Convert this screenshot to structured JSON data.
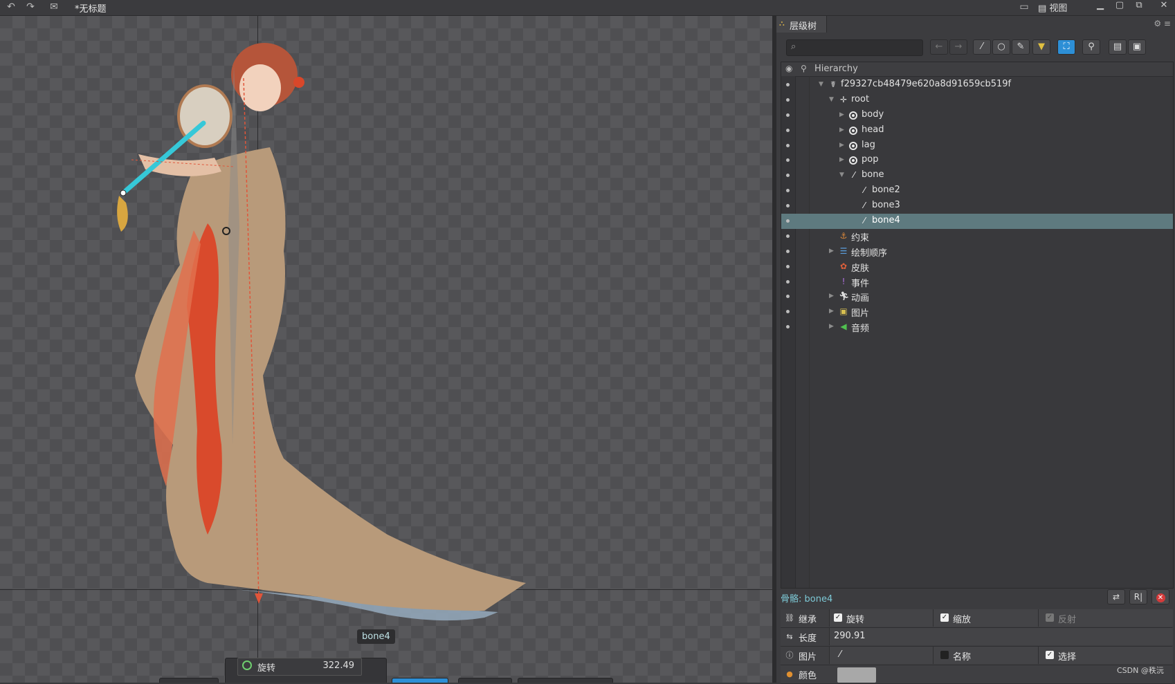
{
  "window": {
    "title": "*无标题",
    "view_menu": "视图",
    "colors": {
      "bg": "#3a3a3c",
      "accent": "#2d8fd6",
      "selection": "#5e7a7f",
      "bone_cyan": "#36c8d8"
    }
  },
  "viewport": {
    "selected_bone_tag": "bone4",
    "transform": {
      "rotate_label": "旋转",
      "rotate_value": "322.49"
    }
  },
  "panel": {
    "tab_label": "层级树",
    "search_placeholder": "",
    "hierarchy_label": "Hierarchy",
    "tree": [
      {
        "label": "f29327cb48479e620a8d91659cb519f",
        "icon": "skeleton-icon",
        "arrow": "down"
      },
      {
        "label": "root",
        "icon": "root-bone-icon",
        "arrow": "down"
      },
      {
        "label": "body",
        "icon": "slot-icon",
        "arrow": "right"
      },
      {
        "label": "head",
        "icon": "slot-icon",
        "arrow": "right"
      },
      {
        "label": "lag",
        "icon": "slot-icon",
        "arrow": "right"
      },
      {
        "label": "pop",
        "icon": "slot-icon",
        "arrow": "right"
      },
      {
        "label": "bone",
        "icon": "bone-icon",
        "arrow": "down"
      },
      {
        "label": "bone2",
        "icon": "bone-icon",
        "arrow": ""
      },
      {
        "label": "bone3",
        "icon": "bone-icon",
        "arrow": ""
      },
      {
        "label": "bone4",
        "icon": "bone-icon",
        "arrow": "",
        "selected": true
      },
      {
        "label": "约束",
        "icon": "constraint-icon",
        "arrow": ""
      },
      {
        "label": "绘制顺序",
        "icon": "draw-order-icon",
        "arrow": "right"
      },
      {
        "label": "皮肤",
        "icon": "skin-icon",
        "arrow": ""
      },
      {
        "label": "事件",
        "icon": "event-icon",
        "arrow": ""
      },
      {
        "label": "动画",
        "icon": "animation-icon",
        "arrow": "right"
      },
      {
        "label": "图片",
        "icon": "images-icon",
        "arrow": "right"
      },
      {
        "label": "音频",
        "icon": "audio-icon",
        "arrow": "right"
      }
    ]
  },
  "properties": {
    "title": "骨骼: bone4",
    "inherit_label": "继承",
    "inherit_rotate": "旋转",
    "inherit_scale": "缩放",
    "inherit_reflect": "反射",
    "length_label": "长度",
    "length_value": "290.91",
    "images_label": "图片",
    "name_label": "名称",
    "select_label": "选择",
    "color_label": "颜色"
  },
  "watermark": "CSDN @秩沅"
}
